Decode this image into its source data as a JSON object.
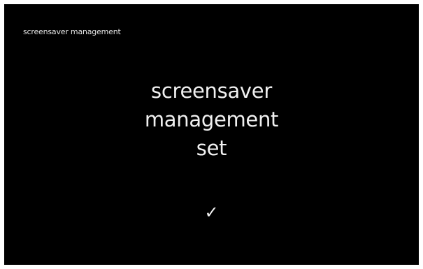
{
  "header": {
    "title": "screensaver management"
  },
  "message": {
    "lines": [
      "screensaver",
      "management",
      "set"
    ]
  },
  "confirmation": {
    "icon": "checkmark-icon",
    "glyph": "✓"
  },
  "colors": {
    "background": "#000000",
    "text": "#f0f0f0",
    "border": "#ffffff"
  }
}
